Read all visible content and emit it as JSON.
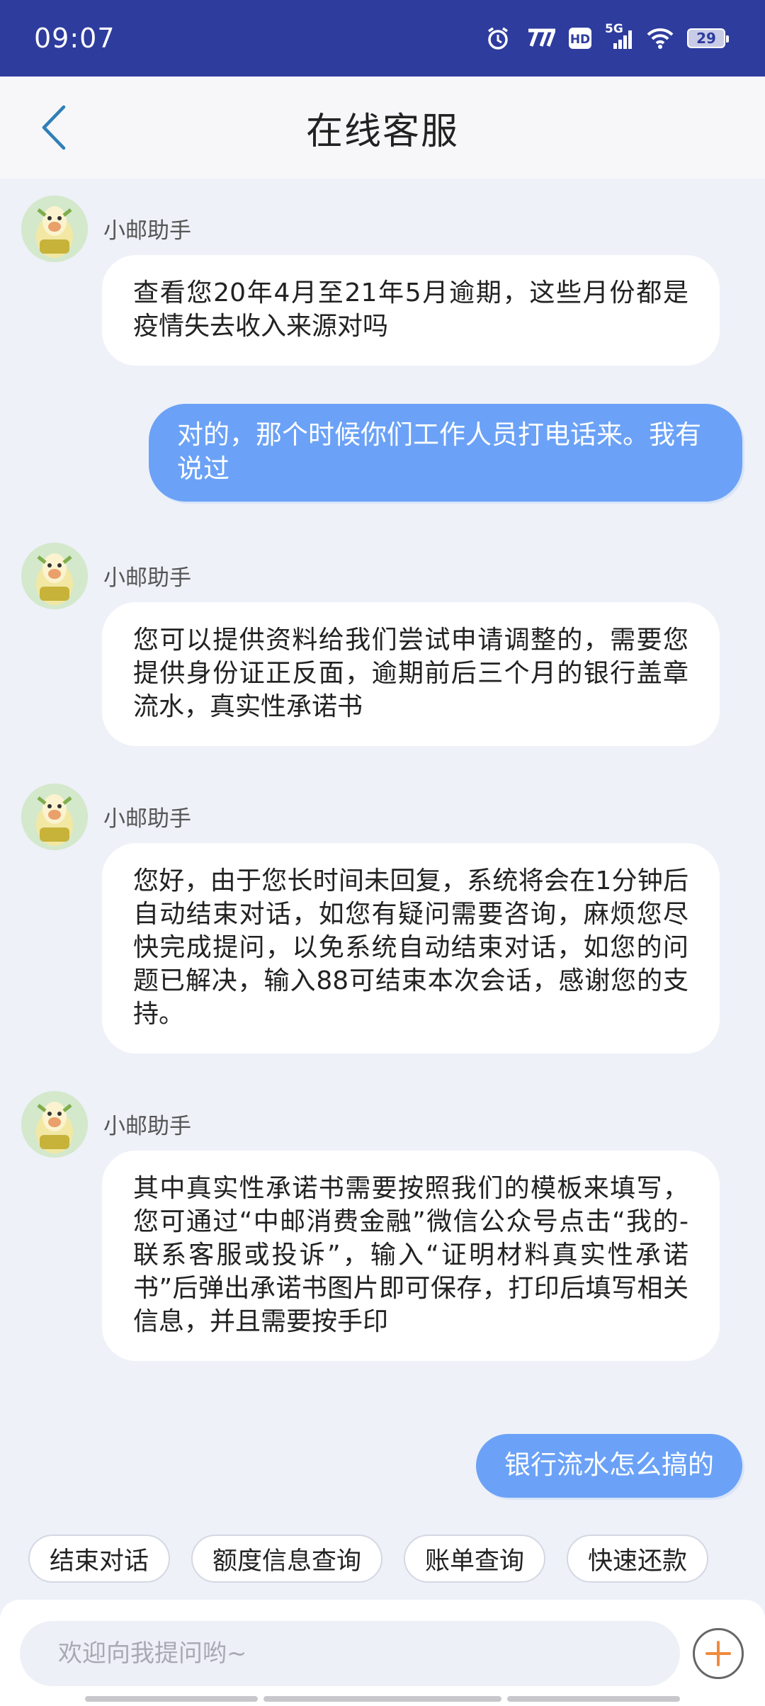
{
  "status_bar": {
    "time": "09:07",
    "network_label": "5G",
    "hd_label": "HD",
    "battery_level": "29",
    "icons": [
      "alarm-icon",
      "network-speed-icon",
      "hd-icon",
      "signal-5g-icon",
      "wifi-icon",
      "battery-icon"
    ]
  },
  "header": {
    "title": "在线客服",
    "back_icon": "chevron-left-icon"
  },
  "messages": [
    {
      "sender": "bot",
      "name": "小邮助手",
      "text": "查看您20年4月至21年5月逾期，这些月份都是疫情失去收入来源对吗"
    },
    {
      "sender": "user",
      "text": "对的，那个时候你们工作人员打电话来。我有说过"
    },
    {
      "sender": "bot",
      "name": "小邮助手",
      "text": "您可以提供资料给我们尝试申请调整的，需要您提供身份证正反面，逾期前后三个月的银行盖章流水，真实性承诺书"
    },
    {
      "sender": "bot",
      "name": "小邮助手",
      "text": "您好，由于您长时间未回复，系统将会在1分钟后自动结束对话，如您有疑问需要咨询，麻烦您尽快完成提问，以免系统自动结束对话，如您的问题已解决，输入88可结束本次会话，感谢您的支持。"
    },
    {
      "sender": "bot",
      "name": "小邮助手",
      "text": "其中真实性承诺书需要按照我们的模板来填写，您可通过“中邮消费金融”微信公众号点击“我的-联系客服或投诉”，输入“证明材料真实性承诺书”后弹出承诺书图片即可保存，打印后填写相关信息，并且需要按手印"
    },
    {
      "sender": "user",
      "text": "银行流水怎么搞的"
    }
  ],
  "quick_replies": [
    "结束对话",
    "额度信息查询",
    "账单查询",
    "快速还款"
  ],
  "input": {
    "placeholder": "欢迎向我提问哟~",
    "value": ""
  },
  "colors": {
    "status_bar": "#2e3c9e",
    "user_bubble": "#6ba2f7",
    "background": "#eef1f8",
    "accent": "#f08a3c"
  }
}
